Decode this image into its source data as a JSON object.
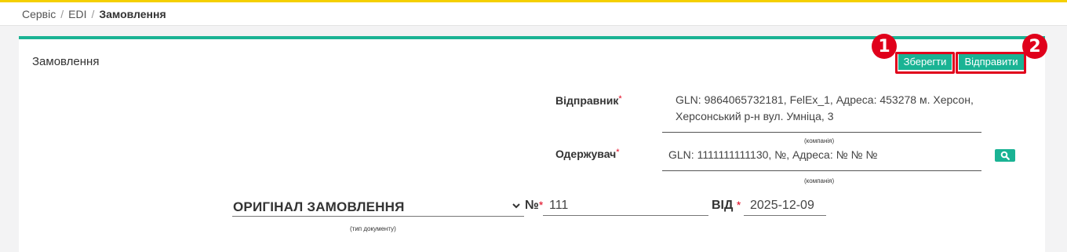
{
  "breadcrumb": {
    "items": [
      "Сервіс",
      "EDI"
    ],
    "separator": "/",
    "current": "Замовлення"
  },
  "panel": {
    "title": "Замовлення",
    "save_label": "Зберегти",
    "send_label": "Відправити",
    "annotation_1": "1",
    "annotation_2": "2"
  },
  "sender": {
    "label": "Відправник",
    "required_mark": "*",
    "line1": "GLN: 9864065732181, FelEx_1, Адреса: 453278 м. Херсон,",
    "line2": "Херсонський р-н вул. Умніца, 3",
    "hint": "(компанія)"
  },
  "receiver": {
    "label": "Одержувач",
    "required_mark": "*",
    "value": "GLN: 1111111111130, №, Адреса: № № №",
    "hint": "(компанія)"
  },
  "document": {
    "type_value": "ОРИГІНАЛ ЗАМОВЛЕННЯ",
    "type_hint": "(тип документу)",
    "number_label": "№",
    "number_required": "*",
    "number_value": "111",
    "date_label": "ВІД",
    "date_required": "*",
    "date_value": "2025-12-09"
  },
  "colors": {
    "accent": "#1ab394",
    "highlight": "#e0001b",
    "topline": "#f5d000"
  }
}
